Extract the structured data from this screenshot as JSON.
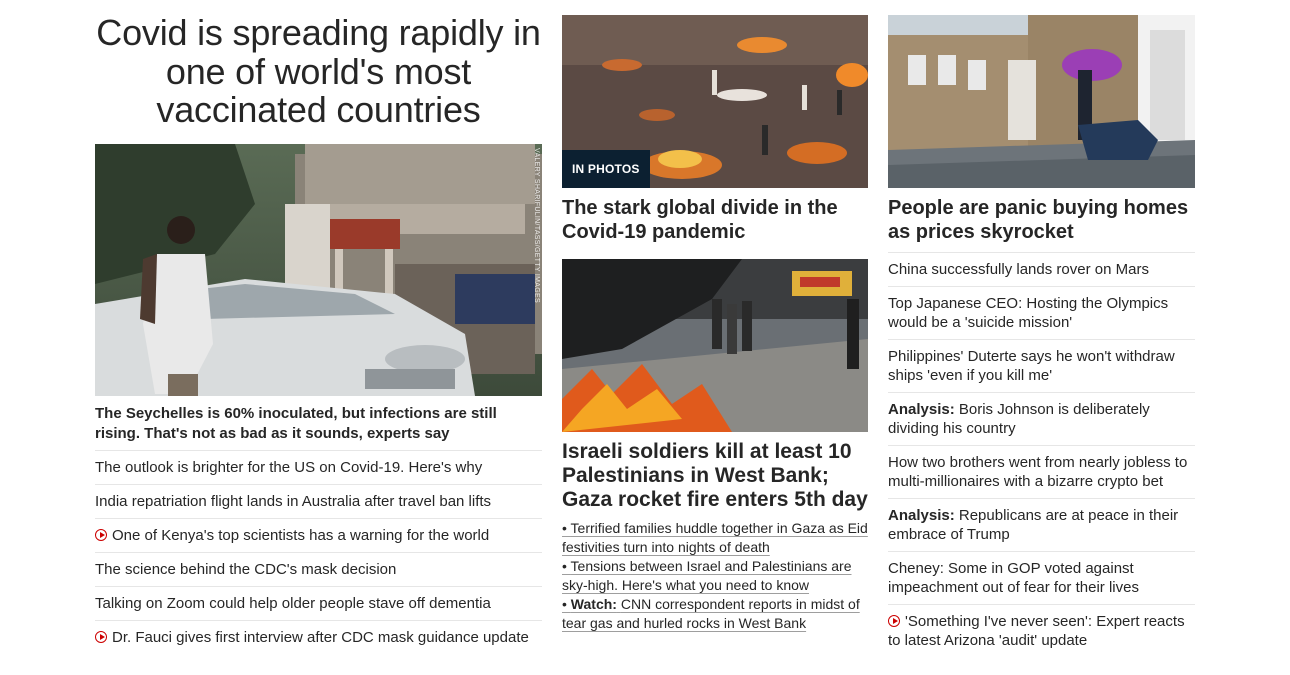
{
  "lead": {
    "title": "Covid is spreading rapidly in one of world's most vaccinated countries",
    "image_credit": "VALERY SHARIFULIN/TASS/GETTY IMAGES",
    "headline": "The Seychelles is 60% inoculated, but infections are still rising. That's not as bad as it sounds, experts say",
    "links": [
      {
        "text": "The outlook is brighter for the US on Covid-19. Here's why",
        "video": false
      },
      {
        "text": "India repatriation flight lands in Australia after travel ban lifts",
        "video": false
      },
      {
        "text": "One of Kenya's top scientists has a warning for the world",
        "video": true
      },
      {
        "text": "The science behind the CDC's mask decision",
        "video": false
      },
      {
        "text": "Talking on Zoom could help older people stave off dementia",
        "video": false
      },
      {
        "text": "Dr. Fauci gives first interview after CDC mask guidance update",
        "video": true
      }
    ]
  },
  "middle": {
    "photo_badge": "IN PHOTOS",
    "story1_headline": "The stark global divide in the Covid-19 pandemic",
    "story2_headline": "Israeli soldiers kill at least 10 Palestinians in West Bank; Gaza rocket fire enters 5th day",
    "bullets": [
      {
        "prefix": "",
        "text": "Terrified families huddle together in Gaza as Eid festivities turn into nights of death"
      },
      {
        "prefix": "",
        "text": "Tensions between Israel and Palestinians are sky-high. Here's what you need to know"
      },
      {
        "prefix": "Watch:",
        "text": "CNN correspondent reports in midst of tear gas and hurled rocks in West Bank"
      }
    ]
  },
  "right": {
    "headline": "People are panic buying homes as prices skyrocket",
    "links": [
      {
        "prefix": "",
        "text": "China successfully lands rover on Mars",
        "video": false
      },
      {
        "prefix": "",
        "text": "Top Japanese CEO: Hosting the Olympics would be a 'suicide mission'",
        "video": false
      },
      {
        "prefix": "",
        "text": "Philippines' Duterte says he won't withdraw ships 'even if you kill me'",
        "video": false
      },
      {
        "prefix": "Analysis:",
        "text": "Boris Johnson is deliberately dividing his country",
        "video": false
      },
      {
        "prefix": "",
        "text": "How two brothers went from nearly jobless to multi-millionaires with a bizarre crypto bet",
        "video": false
      },
      {
        "prefix": "Analysis:",
        "text": "Republicans are at peace in their embrace of Trump",
        "video": false
      },
      {
        "prefix": "",
        "text": "Cheney: Some in GOP voted against impeachment out of fear for their lives",
        "video": false
      },
      {
        "prefix": "",
        "text": "'Something I've never seen': Expert reacts to latest Arizona 'audit' update",
        "video": true
      }
    ]
  },
  "colors": {
    "text": "#262626",
    "badge_bg": "#0c2031",
    "video_red": "#cc0000",
    "divider": "#e6e6e6"
  },
  "icons": [
    "play-icon"
  ]
}
